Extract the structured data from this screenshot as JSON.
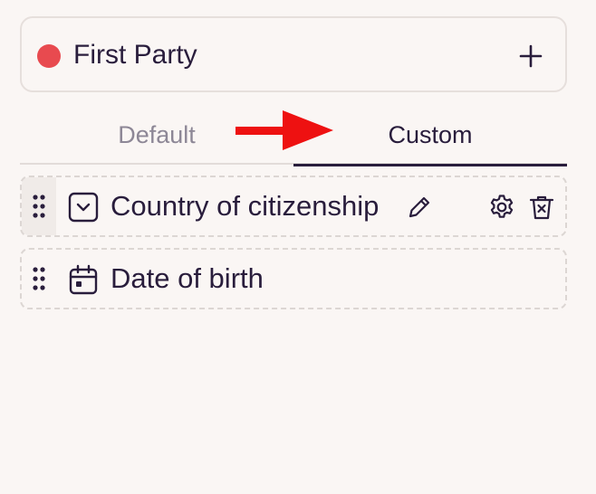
{
  "party": {
    "name": "First Party",
    "dot_color": "#e84a4f",
    "icons": {
      "add": "plus-icon"
    }
  },
  "tabs": [
    {
      "label": "Default",
      "active": false
    },
    {
      "label": "Custom",
      "active": true
    }
  ],
  "annotation": {
    "icon": "red-arrow-pointing-right",
    "color": "#ee1111"
  },
  "fields": [
    {
      "label": "Country of citizenship",
      "type_icon": "dropdown-select-icon",
      "actions": [
        "edit-pencil-icon",
        "gear-icon",
        "trash-icon"
      ]
    },
    {
      "label": "Date of birth",
      "type_icon": "calendar-icon",
      "actions": []
    }
  ],
  "colors": {
    "background": "#faf6f4",
    "text": "#291d3c",
    "muted_text": "#8d8796",
    "border": "#e6dfdc"
  }
}
